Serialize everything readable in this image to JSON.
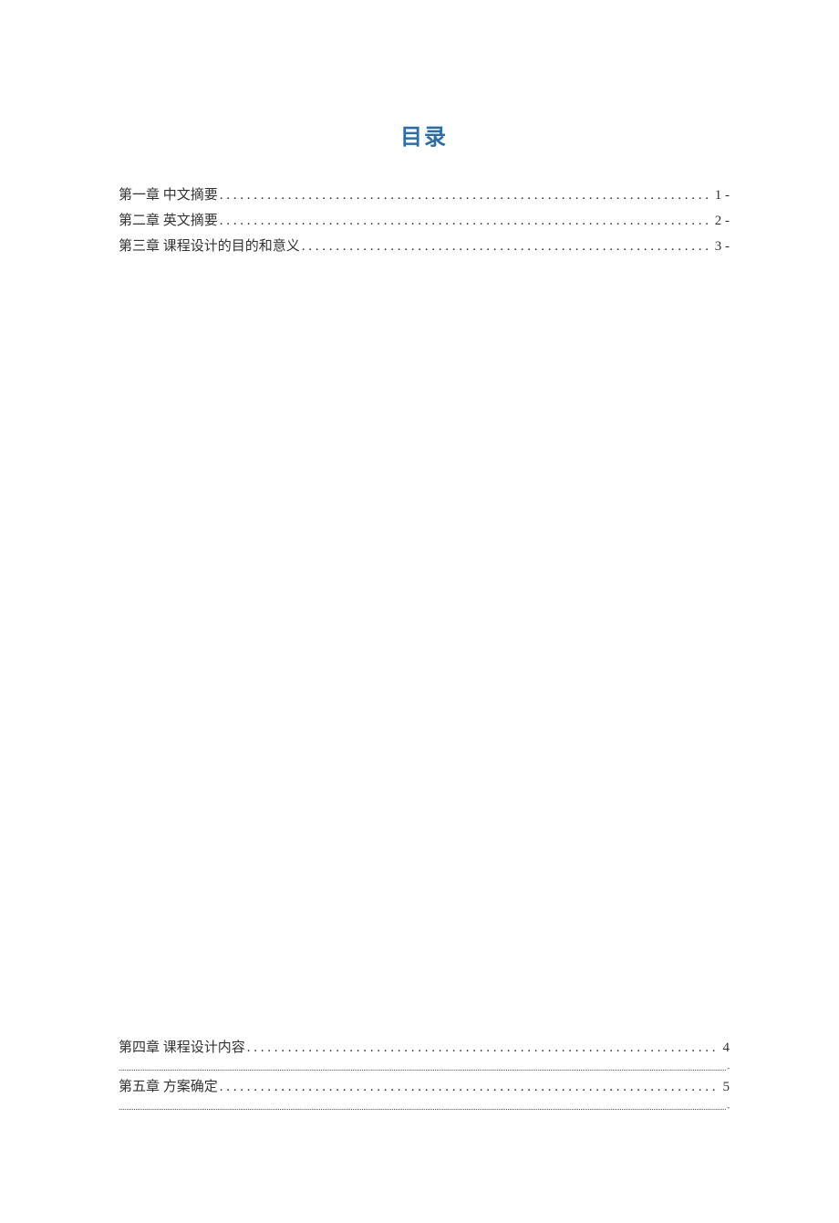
{
  "title": "目录",
  "toc_upper": [
    {
      "label": "第一章  中文摘要",
      "page": "1 -"
    },
    {
      "label": "第二章  英文摘要",
      "page": "2 -"
    },
    {
      "label": "第三章  课程设计的目的和意义",
      "page": "3 -"
    }
  ],
  "toc_lower": [
    {
      "label": "第四章 课程设计内容",
      "page": "4",
      "tail": "-"
    },
    {
      "label": "第五章 方案确定",
      "page": "5",
      "tail": "-"
    }
  ]
}
